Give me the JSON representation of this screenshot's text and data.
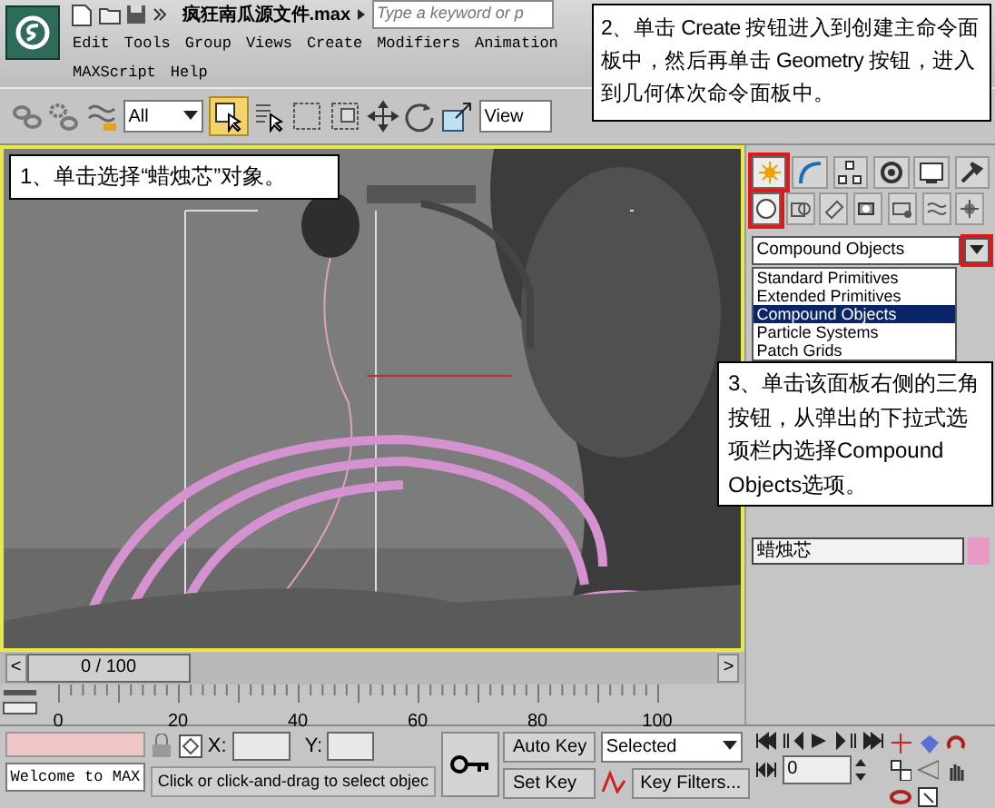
{
  "app": {
    "title": "疯狂南瓜源文件.max",
    "search": {
      "placeholder": "Type a keyword or p"
    },
    "menus": [
      "Edit",
      "Tools",
      "Group",
      "Views",
      "Create",
      "Modifiers",
      "Animation",
      "MAXScript",
      "Help"
    ]
  },
  "toolbar": {
    "selection_filter": "All",
    "reference_coordinate": "View",
    "select_object_active": true
  },
  "command_panel": {
    "tabs": [
      {
        "selected": true,
        "highlighted": true
      },
      {
        "selected": false,
        "highlighted": false
      },
      {
        "selected": false,
        "highlighted": false
      },
      {
        "selected": false,
        "highlighted": false
      },
      {
        "selected": false,
        "highlighted": false
      },
      {
        "selected": false,
        "highlighted": false
      }
    ],
    "categories": [
      {
        "selected": true,
        "highlighted": true
      },
      {
        "selected": false,
        "highlighted": false
      },
      {
        "selected": false,
        "highlighted": false
      },
      {
        "selected": false,
        "highlighted": false
      },
      {
        "selected": false,
        "highlighted": false
      },
      {
        "selected": false,
        "highlighted": false
      },
      {
        "selected": false,
        "highlighted": false
      }
    ],
    "dropdown": {
      "value": "Compound Objects",
      "arrow_highlighted": true
    },
    "options": [
      {
        "label": "Standard Primitives",
        "selected": false
      },
      {
        "label": "Extended Primitives",
        "selected": false
      },
      {
        "label": "Compound Objects",
        "selected": true
      },
      {
        "label": "Particle Systems",
        "selected": false
      },
      {
        "label": "Patch Grids",
        "selected": false
      }
    ],
    "object": {
      "name": "蜡烛芯",
      "color": "#e79ac4"
    }
  },
  "time_slider": {
    "prev": "<",
    "label": "0 / 100",
    "next": ">",
    "level": 0
  },
  "track_bar": {
    "ticks": [
      "0",
      "20",
      "40",
      "60",
      "80",
      "100"
    ]
  },
  "status": {
    "listener": "Welcome to MAX",
    "x_label": "X:",
    "y_label": "Y:",
    "prompt": "Click or click-and-drag to select objec"
  },
  "animation": {
    "auto_key": "Auto Key",
    "set_key": "Set Key",
    "key_mode": "Selected",
    "key_filters": "Key Filters...",
    "frame": "0"
  },
  "callouts": [
    {
      "text": "1、单击选择“蜡烛芯”对象。"
    },
    {
      "text": "2、单击 Create 按钮进入到创建主命令面板中，然后再单击 Geometry 按钮，进入到几何体次命令面板中。"
    },
    {
      "text": "3、单击该面板右侧的三角按钮，从弹出的下拉式选项栏内选择Compound Objects选项。"
    }
  ]
}
